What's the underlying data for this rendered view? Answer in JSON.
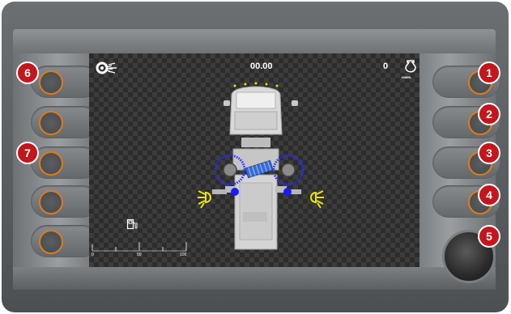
{
  "hud": {
    "timer": "00.00",
    "counter": "0",
    "rpm_unit": "H/MIN"
  },
  "gauge": {
    "labels": [
      "0",
      "50",
      "100"
    ]
  },
  "buttons": {
    "badges": [
      "1",
      "2",
      "3",
      "4",
      "5",
      "6",
      "7"
    ]
  },
  "colors": {
    "badge": "#c4161c",
    "ring": "#e07a1a",
    "brush": "#2b2bff",
    "light": "#e8e800"
  },
  "icons": [
    "engine-key-icon",
    "engine-rpm-icon",
    "fuel-icon",
    "work-light-left-icon",
    "work-light-right-icon"
  ]
}
